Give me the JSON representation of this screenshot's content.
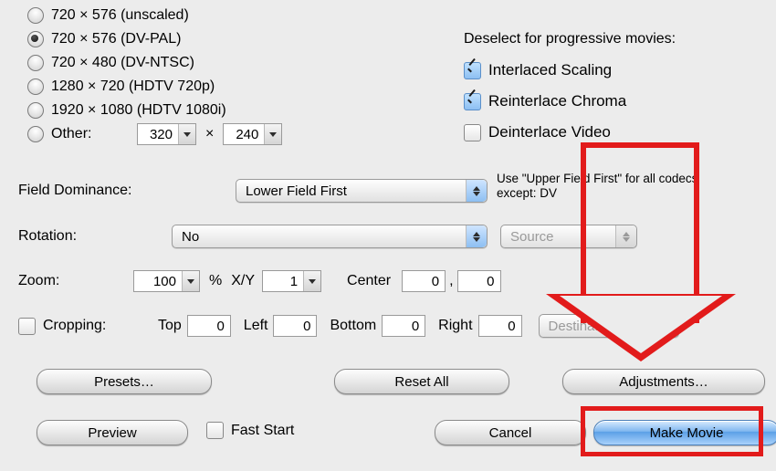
{
  "resolutions": {
    "r1": "720 × 576  (unscaled)",
    "r2": "720 × 576  (DV-PAL)",
    "r3": "720 × 480  (DV-NTSC)",
    "r4": "1280 × 720  (HDTV 720p)",
    "r5": "1920 × 1080  (HDTV 1080i)",
    "other_label": "Other:",
    "other_w": "320",
    "other_h": "240",
    "times": "×"
  },
  "interlace": {
    "heading": "Deselect for progressive movies:",
    "scaling": "Interlaced Scaling",
    "chroma": "Reinterlace Chroma",
    "deint": "Deinterlace Video"
  },
  "field_dominance": {
    "label": "Field Dominance:",
    "value": "Lower Field First",
    "hint": "Use \"Upper Field First\" for all codecs except: DV"
  },
  "rotation": {
    "label": "Rotation:",
    "value": "No",
    "source": "Source"
  },
  "zoom": {
    "label": "Zoom:",
    "value": "100",
    "percent": "%",
    "xy_label": "X/Y",
    "xy_value": "1",
    "center_label": "Center",
    "cx": "0",
    "comma": ",",
    "cy": "0"
  },
  "cropping": {
    "label": "Cropping:",
    "top_label": "Top",
    "top": "0",
    "left_label": "Left",
    "left": "0",
    "bottom_label": "Bottom",
    "bottom": "0",
    "right_label": "Right",
    "right": "0",
    "mode": "Destina..."
  },
  "buttons": {
    "presets": "Presets…",
    "reset_all": "Reset All",
    "adjustments": "Adjustments…",
    "preview": "Preview",
    "fast_start": "Fast Start",
    "cancel": "Cancel",
    "make_movie": "Make Movie"
  }
}
